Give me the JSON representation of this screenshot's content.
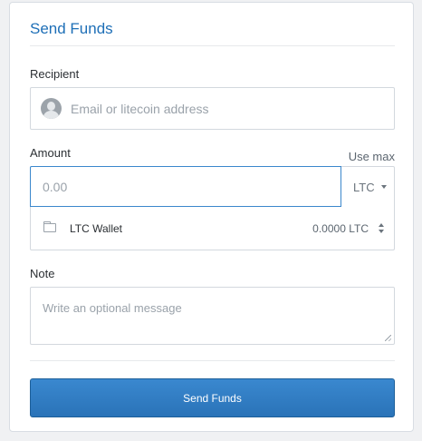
{
  "form": {
    "title": "Send Funds",
    "recipient": {
      "label": "Recipient",
      "placeholder": "Email or litecoin address"
    },
    "amount": {
      "label": "Amount",
      "use_max": "Use max",
      "placeholder": "0.00",
      "currency": "LTC"
    },
    "wallet": {
      "name": "LTC Wallet",
      "balance": "0.0000 LTC"
    },
    "note": {
      "label": "Note",
      "placeholder": "Write an optional message"
    },
    "submit_label": "Send Funds"
  },
  "colors": {
    "accent": "#1e6fb7",
    "button": "#2f7ec4",
    "focus_border": "#3b87cc"
  },
  "icons": [
    "avatar-icon",
    "wallet-icon",
    "chevron-down-icon",
    "stepper-icon",
    "resize-handle-icon"
  ]
}
